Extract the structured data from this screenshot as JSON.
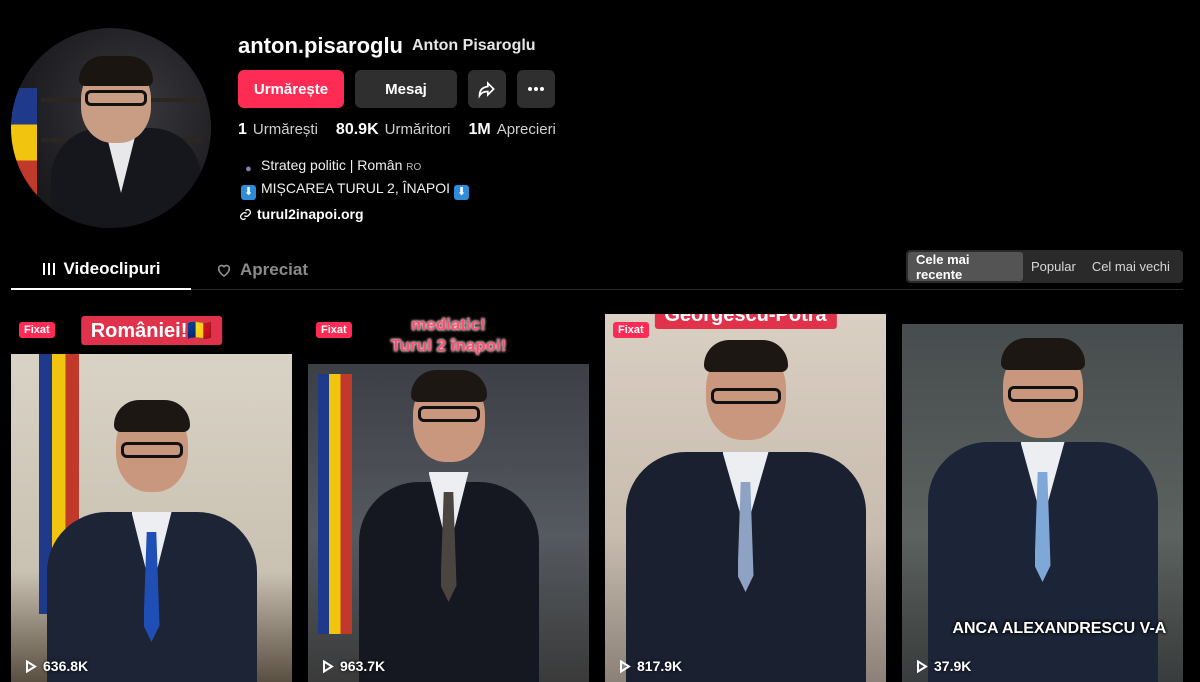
{
  "profile": {
    "username": "anton.pisaroglu",
    "nickname": "Anton Pisaroglu",
    "follow_label": "Urmărește",
    "message_label": "Mesaj",
    "stats": [
      {
        "value": "1",
        "label": "Urmărești"
      },
      {
        "value": "80.9K",
        "label": "Urmăritori"
      },
      {
        "value": "1M",
        "label": "Aprecieri"
      }
    ],
    "bio_line1": "Strateg politic | Român",
    "bio_line1_tag": "RO",
    "bio_line2": "MIȘCAREA TURUL 2, ÎNAPOI",
    "link": "turul2inapoi.org"
  },
  "tabs": {
    "videos": "Videoclipuri",
    "liked": "Apreciat"
  },
  "sort": {
    "options": [
      "Cele mai recente",
      "Popular",
      "Cel mai vechi"
    ],
    "selected": "Cele mai recente"
  },
  "videos": [
    {
      "pinned": "Fixat",
      "caption": "României!🇷🇴",
      "views": "636.8K"
    },
    {
      "pinned": "Fixat",
      "caption_line1": "mediatic!",
      "caption_line2": "Turul 2 înapoi!",
      "views": "963.7K"
    },
    {
      "pinned": "Fixat",
      "caption": "Georgescu-Potra",
      "views": "817.9K"
    },
    {
      "overlay": "ANCA ALEXANDRESCU V-A",
      "views": "37.9K"
    }
  ],
  "colors": {
    "accent": "#fe2c55",
    "button_bg": "#2f2f2f",
    "background": "#000000"
  }
}
